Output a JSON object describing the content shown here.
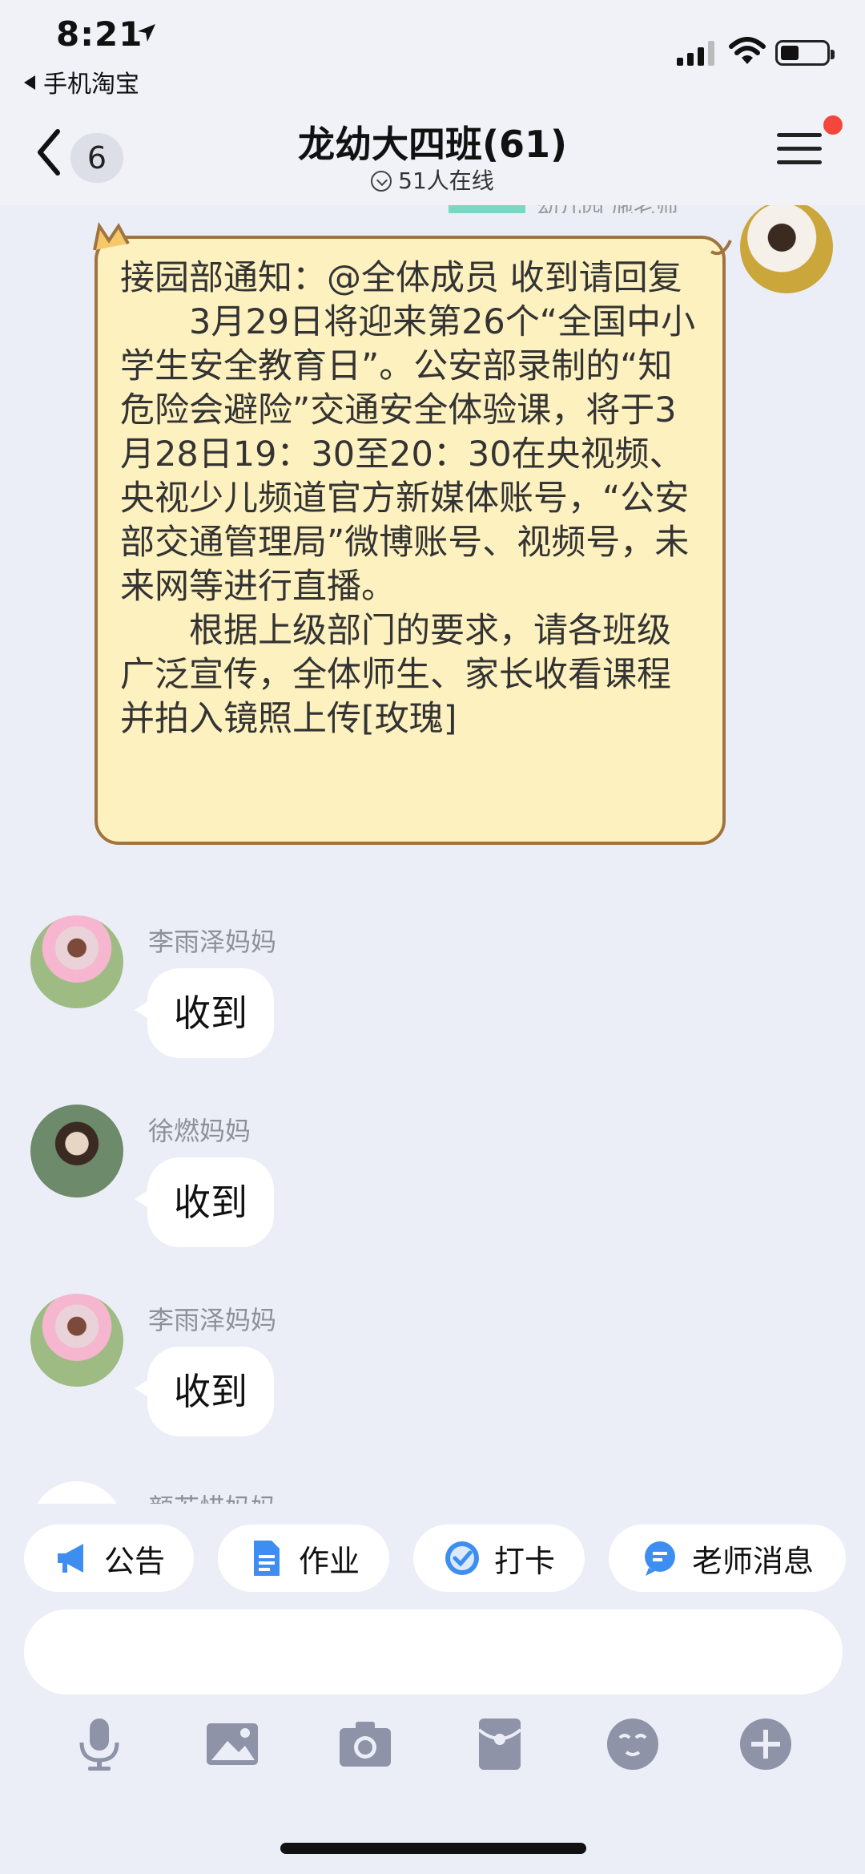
{
  "status_bar": {
    "time": "8:21",
    "back_app": "手机淘宝"
  },
  "header": {
    "back_count": "6",
    "title": "龙幼大四班(61)",
    "online": "51人在线"
  },
  "chat": {
    "partial_sender": "幼儿园 施老师",
    "notice_text": "接园部通知：@全体成员 收到请回复\n　　3月29日将迎来第26个“全国中小学生安全教育日”。公安部录制的“知危险会避险”交通安全体验课，将于3月28日19：30至20：30在央视频、央视少儿频道官方新媒体账号，“公安部交通管理局”微博账号、视频号，未来网等进行直播。\n　　根据上级部门的要求，请各班级广泛宣传，全体师生、家长收看课程并拍入镜照上传[玫瑰]",
    "messages": [
      {
        "sender": "李雨泽妈妈",
        "text": "收到"
      },
      {
        "sender": "徐燃妈妈",
        "text": "收到"
      },
      {
        "sender": "李雨泽妈妈",
        "text": "收到"
      },
      {
        "sender": "颜若惜妈妈",
        "text": ""
      }
    ]
  },
  "quick_actions": {
    "notice": "公告",
    "homework": "作业",
    "checkin": "打卡",
    "teacher_msg": "老师消息"
  },
  "icons": {
    "notice": "megaphone-icon",
    "homework": "document-icon",
    "checkin": "check-circle-icon",
    "teacher_msg": "teacher-chat-icon",
    "toolbar": [
      "microphone-icon",
      "image-icon",
      "camera-icon",
      "red-packet-icon",
      "emoji-icon",
      "plus-icon"
    ]
  },
  "colors": {
    "accent_red": "#f4473c",
    "notice_bg": "#fdf1c0",
    "notice_border": "#a0743f",
    "icon_blue": "#3d8ef0",
    "toolbar_gray": "#8e93a8"
  }
}
